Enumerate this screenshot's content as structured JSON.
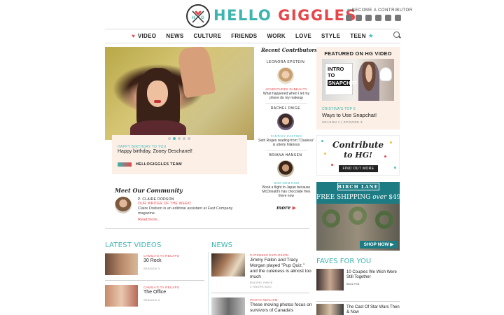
{
  "header": {
    "logo_letters": "H G",
    "logo_hello": "HELLO",
    "logo_giggles": "GIGGLES",
    "contributor_link": "BECOME A CONTRIBUTOR",
    "social_icons": [
      "facebook-icon",
      "twitter-icon",
      "youtube-icon",
      "pinterest-icon",
      "instagram-icon",
      "tumblr-icon"
    ]
  },
  "nav": {
    "items": [
      "VIDEO",
      "NEWS",
      "CULTURE",
      "FRIENDS",
      "WORK",
      "LOVE",
      "STYLE",
      "TEEN"
    ],
    "accent_heart": "#e7454a",
    "accent_star": "#4bbfc0"
  },
  "hero": {
    "kicker": "HAPPY BIRTHDAY TO YOU",
    "title": "Happy birthday, Zooey Deschanel!",
    "author": "HELLOGIGGLES TEAM",
    "slide_count": 5,
    "active_slide": 2
  },
  "community": {
    "title": "Meet Our Community",
    "name": "P. CLAIRE DODSON",
    "subtitle": "OUR WRITER OF THE WEEK!",
    "description": "Claire Dodson is an editorial assistant at Fast Company magazine.",
    "more": "Read more.."
  },
  "recent_contributors": {
    "title": "Recent Contributors",
    "items": [
      {
        "name": "LEONORA EPSTEIN",
        "kicker": "ADVENTURES IN BEAUTY",
        "text": "What happened when I let my phone do my makeup"
      },
      {
        "name": "RACHEL PAIGE",
        "kicker": "FANTASY CASTING",
        "text": "Seth Rogen reading from \"Clueless\" is utterly hilarious"
      },
      {
        "name": "BRIANA HANSEN",
        "kicker": "NOM NOM NOM",
        "text": "Book a flight to Japan because McDonald's has chocolate fries there now"
      }
    ],
    "more": "more",
    "more_arrow": "▶"
  },
  "featured_video": {
    "title": "FEATURED ON HG VIDEO",
    "sign_line1": "INTRO",
    "sign_line2": "TO",
    "sign_line3": "SNAPCHAT",
    "kicker": "CRISTINA'S TOP 5",
    "headline": "Ways to Use Snapchat!",
    "episode": "SEASON 1 | EPISODE 3"
  },
  "contribute_ad": {
    "line1": "Contribute",
    "line2": "to HG!",
    "button": "FIND OUT MORE"
  },
  "birch_ad": {
    "brand": "BIRCH LANE",
    "shipping_prefix": "FREE SHIPPING ",
    "shipping_over": "over",
    "shipping_amount": " $49",
    "button": "SHOP NOW ▶"
  },
  "latest_videos": {
    "title": "LATEST VIDEOS",
    "items": [
      {
        "kicker": "CAMILA'S TV RECAPS",
        "name": "30 Rock",
        "season": "SEASON 3"
      },
      {
        "kicker": "CAMILA'S TV RECAPS",
        "name": "The Office",
        "season": "SEASON 3"
      }
    ]
  },
  "news": {
    "title": "NEWS",
    "items": [
      {
        "kicker": "CUTENESS EXPLOSION",
        "text": "Jimmy Fallon and Tracy Morgan played \"Pup Quiz,\" and the cuteness is almost too much",
        "author": "RACHEL PAIGE",
        "time": "3 HOURS AGO"
      },
      {
        "kicker": "PHOTO REALISM",
        "text": "These moving photos focus on survivors of Canada's",
        "author": "",
        "time": ""
      }
    ]
  },
  "faves": {
    "title": "FAVES FOR YOU",
    "items": [
      {
        "text": "10 Couples We Wish Were Still Together",
        "source": "Buzz Hot"
      },
      {
        "text": "The Cast Of Star Wars Then & Now",
        "source": ""
      }
    ]
  }
}
